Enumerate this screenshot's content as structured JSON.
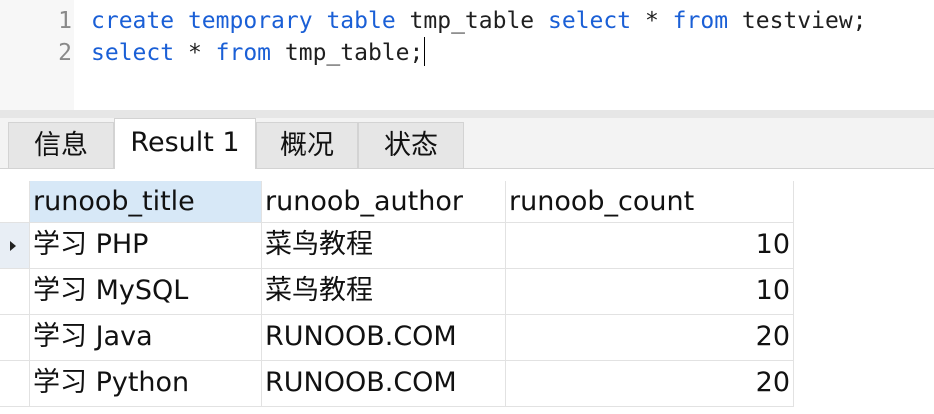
{
  "editor": {
    "lines": [
      {
        "number": "1",
        "tokens": [
          {
            "text": "create",
            "kw": true
          },
          {
            "text": " ",
            "kw": false
          },
          {
            "text": "temporary",
            "kw": true
          },
          {
            "text": " ",
            "kw": false
          },
          {
            "text": "table",
            "kw": true
          },
          {
            "text": " tmp_table ",
            "kw": false
          },
          {
            "text": "select",
            "kw": true
          },
          {
            "text": " * ",
            "kw": false
          },
          {
            "text": "from",
            "kw": true
          },
          {
            "text": " testview;",
            "kw": false
          }
        ]
      },
      {
        "number": "2",
        "tokens": [
          {
            "text": "select",
            "kw": true
          },
          {
            "text": " * ",
            "kw": false
          },
          {
            "text": "from",
            "kw": true
          },
          {
            "text": " tmp_table;",
            "kw": false
          }
        ]
      }
    ]
  },
  "tabs": [
    {
      "label": "信息",
      "active": false
    },
    {
      "label": "Result 1",
      "active": true
    },
    {
      "label": "概况",
      "active": false
    },
    {
      "label": "状态",
      "active": false
    }
  ],
  "grid": {
    "columns": [
      "runoob_title",
      "runoob_author",
      "runoob_count"
    ],
    "rows": [
      [
        "学习 PHP",
        "菜鸟教程",
        "10"
      ],
      [
        "学习 MySQL",
        "菜鸟教程",
        "10"
      ],
      [
        "学习 Java",
        "RUNOOB.COM",
        "20"
      ],
      [
        "学习 Python",
        "RUNOOB.COM",
        "20"
      ]
    ],
    "current_row": 0
  },
  "colors": {
    "keyword": "#1a5fd6",
    "selected_header": "#d7e8f7"
  }
}
